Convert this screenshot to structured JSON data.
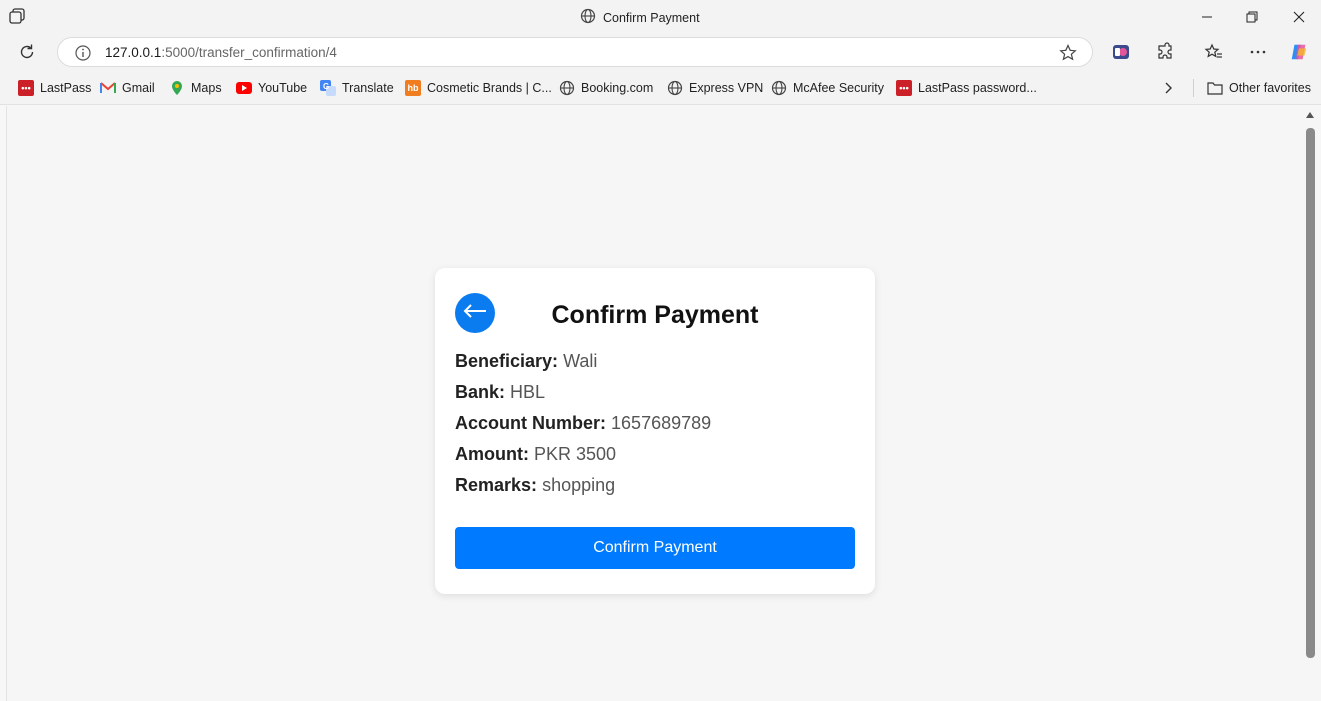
{
  "window": {
    "title": "Confirm Payment",
    "controls": [
      "minimize",
      "restore",
      "close"
    ]
  },
  "address_bar": {
    "url_host": "127.0.0.1",
    "url_path": ":5000/transfer_confirmation/4"
  },
  "bookmarks": {
    "items": [
      {
        "label": "LastPass",
        "icon": "lastpass-icon",
        "color": "#cc2029"
      },
      {
        "label": "Gmail",
        "icon": "gmail-icon",
        "color": "#ea4335"
      },
      {
        "label": "Maps",
        "icon": "maps-icon",
        "color": "#34a853"
      },
      {
        "label": "YouTube",
        "icon": "youtube-icon",
        "color": "#ff0000"
      },
      {
        "label": "Translate",
        "icon": "translate-icon",
        "color": "#4285f4"
      },
      {
        "label": "Cosmetic Brands | C...",
        "icon": "hb-icon",
        "color": "#f07d1f"
      },
      {
        "label": "Booking.com",
        "icon": "globe-icon",
        "color": "#555555"
      },
      {
        "label": "Express VPN",
        "icon": "globe-icon",
        "color": "#555555"
      },
      {
        "label": "McAfee Security",
        "icon": "globe-icon",
        "color": "#555555"
      },
      {
        "label": "LastPass password...",
        "icon": "lastpass-icon",
        "color": "#cc2029"
      }
    ],
    "other_favorites": "Other favorites"
  },
  "card": {
    "title": "Confirm Payment",
    "back_icon": "arrow-left-icon",
    "details": [
      {
        "label": "Beneficiary:",
        "value": "Wali"
      },
      {
        "label": "Bank:",
        "value": "HBL"
      },
      {
        "label": "Account Number:",
        "value": "1657689789"
      },
      {
        "label": "Amount:",
        "value": "PKR 3500"
      },
      {
        "label": "Remarks:",
        "value": "shopping"
      }
    ],
    "confirm_label": "Confirm Payment"
  },
  "colors": {
    "primary": "#007bff",
    "back_button": "#0a7cf0"
  }
}
